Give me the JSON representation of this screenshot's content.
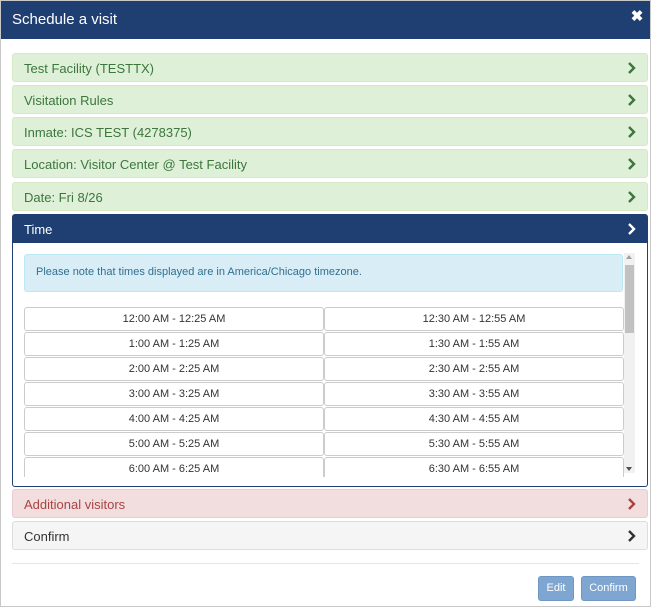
{
  "dialog": {
    "title": "Schedule a visit",
    "close_glyph": "✖"
  },
  "steps": [
    {
      "label": "Test Facility (TESTTX)",
      "state": "completed"
    },
    {
      "label": "Visitation Rules",
      "state": "completed"
    },
    {
      "label": "Inmate: ICS TEST (4278375)",
      "state": "completed"
    },
    {
      "label": "Location: Visitor Center @ Test Facility",
      "state": "completed"
    },
    {
      "label": "Date: Fri 8/26",
      "state": "completed"
    }
  ],
  "time_panel": {
    "label": "Time",
    "notice": "Please note that times displayed are in America/Chicago timezone.",
    "slots": [
      [
        "12:00 AM - 12:25 AM",
        "12:30 AM - 12:55 AM"
      ],
      [
        "1:00 AM - 1:25 AM",
        "1:30 AM - 1:55 AM"
      ],
      [
        "2:00 AM - 2:25 AM",
        "2:30 AM - 2:55 AM"
      ],
      [
        "3:00 AM - 3:25 AM",
        "3:30 AM - 3:55 AM"
      ],
      [
        "4:00 AM - 4:25 AM",
        "4:30 AM - 4:55 AM"
      ],
      [
        "5:00 AM - 5:25 AM",
        "5:30 AM - 5:55 AM"
      ],
      [
        "6:00 AM - 6:25 AM",
        "6:30 AM - 6:55 AM"
      ]
    ]
  },
  "additional_visitors": {
    "label": "Additional visitors",
    "state": "error"
  },
  "confirm_step": {
    "label": "Confirm",
    "state": "pending"
  },
  "footer": {
    "edit_label": "Edit",
    "confirm_label": "Confirm"
  },
  "colors": {
    "header": "#1f3f72",
    "success_bg": "#dff0d8",
    "success_text": "#3c763d",
    "danger_bg": "#f2dede",
    "danger_text": "#a94442",
    "info_bg": "#d9edf7",
    "button": "#7fa6d1"
  },
  "icons": {
    "close": "close-icon",
    "chevron": "chevron-right-icon"
  }
}
